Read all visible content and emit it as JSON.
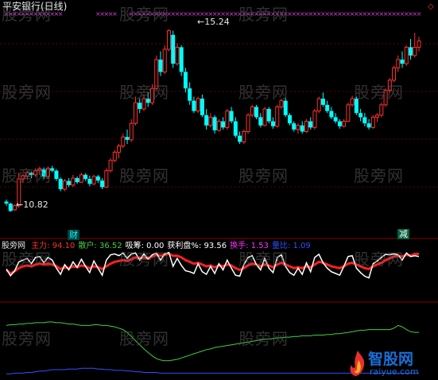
{
  "title": "平安银行(日线)",
  "price_labels": {
    "high": "15.24",
    "low": "10.82"
  },
  "signals": {
    "buy": "财",
    "sell": "减"
  },
  "legend": [
    {
      "label": "主力",
      "value": "94.10",
      "color": "#ff3030"
    },
    {
      "label": "散户",
      "value": "36.52",
      "color": "#40d040"
    },
    {
      "label": "吸筹",
      "value": "0.00",
      "color": "#ffffff"
    },
    {
      "label": "获利盘%",
      "value": "93.56",
      "color": "#ffffff"
    },
    {
      "label": "换手",
      "value": "1.53",
      "color": "#ff30ff"
    },
    {
      "label": "量比",
      "value": "1.09",
      "color": "#3050ff"
    }
  ],
  "legend_prefix": "股旁网",
  "watermark_text": "股旁网",
  "logo": {
    "name": "智股网",
    "url": "raiyue.com"
  },
  "colors": {
    "up": "#ff3030",
    "down": "#00ffff",
    "cross": "#d040d0",
    "main": "#ff2020",
    "retail": "#40d040",
    "profit": "#ffffff",
    "volratio": "#3050ff"
  },
  "chart_data": {
    "type": "candlestick",
    "title": "平安银行(日线)",
    "candles": [
      [
        11.05,
        11.1,
        10.95,
        11.0
      ],
      [
        11.0,
        11.02,
        10.8,
        10.82
      ],
      [
        10.85,
        10.98,
        10.82,
        10.95
      ],
      [
        10.95,
        11.75,
        10.9,
        11.6
      ],
      [
        11.6,
        11.72,
        11.5,
        11.68
      ],
      [
        11.66,
        11.8,
        11.58,
        11.75
      ],
      [
        11.75,
        11.78,
        11.62,
        11.7
      ],
      [
        11.7,
        11.86,
        11.65,
        11.8
      ],
      [
        11.8,
        11.9,
        11.7,
        11.85
      ],
      [
        11.84,
        11.88,
        11.6,
        11.66
      ],
      [
        11.66,
        11.9,
        11.6,
        11.86
      ],
      [
        11.86,
        11.92,
        11.76,
        11.8
      ],
      [
        11.8,
        11.84,
        11.55,
        11.6
      ],
      [
        11.6,
        11.64,
        11.3,
        11.35
      ],
      [
        11.35,
        11.6,
        11.3,
        11.55
      ],
      [
        11.55,
        11.62,
        11.4,
        11.45
      ],
      [
        11.45,
        11.7,
        11.4,
        11.62
      ],
      [
        11.62,
        11.66,
        11.48,
        11.52
      ],
      [
        11.52,
        11.75,
        11.5,
        11.7
      ],
      [
        11.7,
        11.74,
        11.55,
        11.6
      ],
      [
        11.6,
        11.68,
        11.42,
        11.48
      ],
      [
        11.48,
        11.7,
        11.45,
        11.66
      ],
      [
        11.66,
        11.7,
        11.5,
        11.56
      ],
      [
        11.56,
        11.62,
        11.35,
        11.4
      ],
      [
        11.4,
        11.86,
        11.38,
        11.8
      ],
      [
        11.8,
        12.1,
        11.75,
        12.05
      ],
      [
        12.05,
        12.3,
        12.0,
        12.25
      ],
      [
        12.25,
        12.45,
        12.1,
        12.4
      ],
      [
        12.4,
        12.7,
        12.35,
        12.62
      ],
      [
        12.62,
        12.8,
        12.45,
        12.55
      ],
      [
        12.55,
        13.05,
        12.5,
        12.95
      ],
      [
        12.95,
        13.6,
        12.9,
        13.45
      ],
      [
        13.45,
        13.55,
        13.2,
        13.3
      ],
      [
        13.3,
        13.65,
        13.25,
        13.55
      ],
      [
        13.55,
        13.7,
        13.35,
        13.45
      ],
      [
        13.45,
        13.9,
        13.4,
        13.8
      ],
      [
        13.8,
        14.6,
        13.75,
        14.5
      ],
      [
        14.5,
        14.7,
        14.1,
        14.2
      ],
      [
        14.2,
        14.85,
        14.15,
        14.75
      ],
      [
        14.75,
        15.24,
        14.7,
        15.2
      ],
      [
        15.1,
        15.2,
        14.3,
        14.4
      ],
      [
        14.4,
        14.9,
        14.35,
        14.8
      ],
      [
        14.8,
        14.85,
        14.1,
        14.2
      ],
      [
        14.2,
        14.3,
        13.7,
        13.8
      ],
      [
        13.8,
        13.95,
        13.4,
        13.5
      ],
      [
        13.5,
        13.6,
        13.2,
        13.25
      ],
      [
        13.25,
        13.6,
        13.2,
        13.55
      ],
      [
        13.55,
        13.65,
        13.1,
        13.15
      ],
      [
        13.15,
        13.3,
        12.8,
        12.9
      ],
      [
        12.9,
        13.2,
        12.85,
        13.1
      ],
      [
        13.1,
        13.15,
        12.7,
        12.78
      ],
      [
        12.78,
        13.05,
        12.75,
        13.0
      ],
      [
        13.0,
        13.1,
        12.8,
        12.85
      ],
      [
        12.85,
        13.3,
        12.8,
        13.25
      ],
      [
        13.25,
        13.35,
        12.95,
        13.0
      ],
      [
        13.0,
        13.1,
        12.6,
        12.65
      ],
      [
        12.65,
        12.75,
        12.45,
        12.5
      ],
      [
        12.5,
        12.8,
        12.45,
        12.75
      ],
      [
        12.75,
        13.2,
        12.7,
        13.15
      ],
      [
        13.15,
        13.4,
        13.1,
        13.35
      ],
      [
        13.35,
        13.4,
        13.05,
        13.1
      ],
      [
        13.1,
        13.2,
        12.85,
        12.9
      ],
      [
        12.9,
        13.35,
        12.88,
        13.3
      ],
      [
        13.3,
        13.35,
        12.95,
        13.0
      ],
      [
        13.0,
        13.1,
        12.82,
        12.88
      ],
      [
        12.88,
        13.4,
        12.85,
        13.35
      ],
      [
        13.35,
        13.55,
        13.3,
        13.5
      ],
      [
        13.5,
        13.58,
        13.1,
        13.15
      ],
      [
        13.15,
        13.2,
        12.9,
        12.95
      ],
      [
        12.95,
        13.0,
        12.75,
        12.8
      ],
      [
        12.8,
        12.95,
        12.7,
        12.9
      ],
      [
        12.9,
        13.0,
        12.7,
        12.75
      ],
      [
        12.75,
        13.05,
        12.72,
        13.0
      ],
      [
        13.0,
        13.1,
        12.8,
        12.85
      ],
      [
        12.85,
        13.3,
        12.8,
        13.25
      ],
      [
        13.25,
        13.6,
        13.2,
        13.55
      ],
      [
        13.55,
        13.7,
        13.35,
        13.4
      ],
      [
        13.4,
        13.5,
        13.2,
        13.25
      ],
      [
        13.25,
        13.35,
        13.05,
        13.1
      ],
      [
        13.1,
        13.2,
        12.95,
        13.0
      ],
      [
        13.0,
        13.05,
        12.82,
        12.88
      ],
      [
        12.88,
        13.05,
        12.85,
        13.0
      ],
      [
        13.0,
        13.45,
        12.98,
        13.4
      ],
      [
        13.4,
        13.62,
        13.35,
        13.55
      ],
      [
        13.55,
        13.6,
        13.15,
        13.2
      ],
      [
        13.2,
        13.3,
        13.0,
        13.1
      ],
      [
        13.1,
        13.2,
        12.88,
        12.95
      ],
      [
        12.95,
        13.05,
        12.8,
        12.85
      ],
      [
        12.85,
        13.15,
        12.82,
        13.1
      ],
      [
        13.1,
        13.2,
        12.98,
        13.15
      ],
      [
        13.15,
        13.45,
        13.1,
        13.4
      ],
      [
        13.4,
        13.8,
        13.35,
        13.75
      ],
      [
        13.75,
        14.05,
        13.7,
        14.0
      ],
      [
        14.0,
        14.35,
        13.95,
        14.3
      ],
      [
        14.3,
        14.6,
        14.2,
        14.5
      ],
      [
        14.5,
        14.7,
        14.3,
        14.4
      ],
      [
        14.4,
        14.85,
        14.35,
        14.8
      ],
      [
        14.8,
        15.0,
        14.5,
        14.6
      ],
      [
        14.6,
        15.15,
        14.55,
        14.8
      ],
      [
        14.8,
        15.05,
        14.7,
        14.95
      ]
    ],
    "main_force": [
      58,
      50,
      55,
      62,
      66,
      68,
      66,
      70,
      72,
      70,
      72,
      70,
      66,
      60,
      64,
      62,
      66,
      64,
      68,
      66,
      62,
      66,
      64,
      60,
      66,
      72,
      76,
      78,
      80,
      78,
      82,
      86,
      84,
      86,
      84,
      88,
      92,
      90,
      92,
      94,
      90,
      90,
      86,
      80,
      76,
      72,
      74,
      70,
      66,
      68,
      64,
      68,
      66,
      70,
      68,
      62,
      58,
      62,
      68,
      72,
      70,
      66,
      70,
      68,
      64,
      70,
      74,
      70,
      66,
      62,
      64,
      62,
      66,
      64,
      70,
      76,
      74,
      70,
      66,
      64,
      62,
      66,
      72,
      74,
      70,
      66,
      62,
      60,
      66,
      70,
      74,
      80,
      84,
      88,
      90,
      88,
      92,
      90,
      94,
      94
    ],
    "profit_pct": [
      60,
      45,
      56,
      76,
      80,
      84,
      72,
      86,
      88,
      74,
      86,
      80,
      62,
      48,
      70,
      58,
      76,
      64,
      82,
      66,
      52,
      78,
      62,
      46,
      80,
      92,
      94,
      90,
      96,
      84,
      94,
      96,
      80,
      94,
      82,
      92,
      96,
      80,
      94,
      97,
      66,
      84,
      68,
      56,
      54,
      50,
      72,
      54,
      48,
      66,
      50,
      72,
      58,
      80,
      62,
      46,
      44,
      70,
      86,
      90,
      70,
      58,
      84,
      62,
      52,
      86,
      92,
      66,
      52,
      46,
      62,
      48,
      74,
      54,
      86,
      93,
      74,
      62,
      54,
      50,
      46,
      66,
      88,
      90,
      62,
      52,
      44,
      40,
      72,
      78,
      86,
      93,
      92,
      94,
      92,
      80,
      96,
      88,
      90,
      88
    ],
    "retail_line": [
      72,
      73,
      73,
      74,
      74,
      75,
      75,
      76,
      76,
      76,
      77,
      77,
      76,
      76,
      75,
      74,
      74,
      73,
      72,
      72,
      72,
      73,
      73,
      72,
      72,
      71,
      70,
      68,
      66,
      62,
      56,
      50,
      44,
      38,
      33,
      28,
      24,
      22,
      21,
      21,
      22,
      23,
      25,
      27,
      29,
      31,
      33,
      35,
      37,
      38,
      40,
      41,
      42,
      43,
      44,
      45,
      46,
      47,
      48,
      49,
      50,
      51,
      52,
      52,
      53,
      54,
      54,
      55,
      55,
      56,
      56,
      57,
      57,
      57,
      58,
      58,
      58,
      59,
      59,
      60,
      60,
      61,
      62,
      63,
      64,
      65,
      65,
      66,
      66,
      66,
      66,
      66,
      66,
      68,
      72,
      70,
      66,
      63,
      62,
      62
    ],
    "vol_ratio_line": [
      2,
      2,
      3,
      3,
      3,
      4,
      4,
      5,
      6,
      6,
      7,
      8,
      8,
      8,
      8,
      9,
      9,
      9,
      10,
      10,
      10,
      10,
      9,
      9,
      8,
      8,
      7,
      7,
      7,
      6,
      6,
      5,
      5,
      4,
      4,
      4,
      4,
      3,
      3,
      3,
      3,
      3,
      3,
      3,
      3,
      3,
      3,
      3,
      3,
      3,
      3,
      3,
      3,
      3,
      3,
      3,
      3,
      3,
      3,
      3,
      3,
      3,
      3,
      3,
      3,
      3,
      3,
      3,
      3,
      3,
      3,
      3,
      3,
      3,
      3,
      3,
      3,
      3,
      3,
      3,
      3,
      3,
      3,
      3,
      3,
      3,
      3,
      3,
      3,
      3,
      3,
      3,
      3,
      3,
      3,
      3,
      3,
      3,
      3,
      3
    ]
  }
}
